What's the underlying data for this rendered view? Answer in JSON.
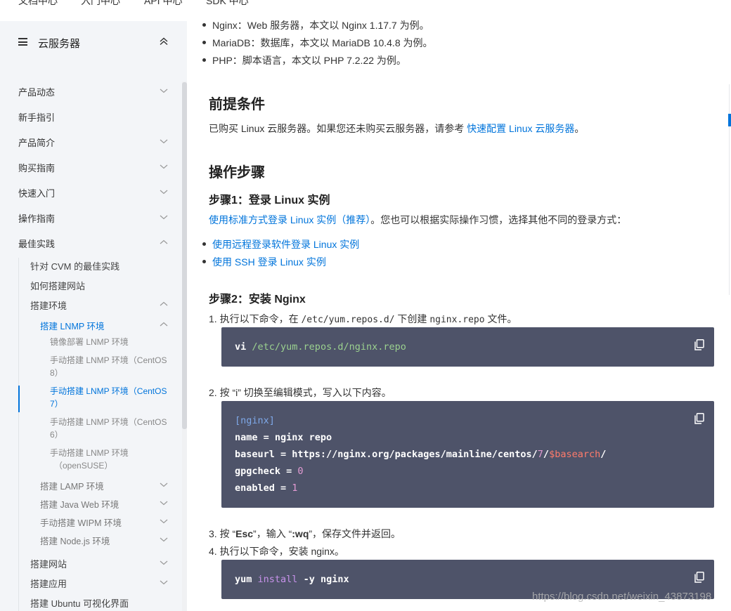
{
  "topnav": [
    "文档中心",
    "入门中心",
    "API 中心",
    "SDK 中心"
  ],
  "sidebar": {
    "title": "云服务器",
    "items": [
      {
        "label": "产品动态",
        "expand": "down"
      },
      {
        "label": "新手指引",
        "expand": "none"
      },
      {
        "label": "产品简介",
        "expand": "down"
      },
      {
        "label": "购买指南",
        "expand": "down"
      },
      {
        "label": "快速入门",
        "expand": "down"
      },
      {
        "label": "操作指南",
        "expand": "down"
      },
      {
        "label": "最佳实践",
        "expand": "up"
      }
    ],
    "best_practice": [
      {
        "label": "针对 CVM 的最佳实践"
      },
      {
        "label": "如何搭建网站"
      },
      {
        "label": "搭建环境"
      }
    ],
    "lnmp": {
      "label": "搭建 LNMP 环境"
    },
    "lnmp_children": [
      {
        "label": "镜像部署 LNMP 环境"
      },
      {
        "label1": "手动搭建 LNMP 环境（CentOS",
        "label2": "8）"
      },
      {
        "label1": "手动搭建 LNMP 环境（CentOS",
        "label2": "7）"
      },
      {
        "label1": "手动搭建 LNMP 环境（CentOS",
        "label2": "6）"
      },
      {
        "label1": "手动搭建 LNMP 环境",
        "label2": "（openSUSE）"
      }
    ],
    "env_more": [
      {
        "label": "搭建 LAMP 环境"
      },
      {
        "label": "搭建 Java Web 环境"
      },
      {
        "label": "手动搭建 WIPM 环境"
      },
      {
        "label": "搭建 Node.js 环境"
      }
    ],
    "bottom": [
      {
        "label": "搭建网站"
      },
      {
        "label": "搭建应用"
      },
      {
        "label": "搭建 Ubuntu 可视化界面"
      }
    ]
  },
  "content": {
    "bullets_top": [
      "Nginx：Web 服务器，本文以 Nginx 1.17.7 为例。",
      "MariaDB：数据库，本文以 MariaDB 10.4.8 为例。",
      "PHP：脚本语言，本文以 PHP 7.2.22 为例。"
    ],
    "prereq_title": "前提条件",
    "prereq_text": "已购买 Linux 云服务器。如果您还未购买云服务器，请参考 ",
    "prereq_link": "快速配置 Linux 云服务器",
    "prereq_end": "。",
    "steps_title": "操作步骤",
    "step1_title": "步骤1：登录 Linux 实例",
    "step1_link": "使用标准方式登录 Linux 实例（推荐）",
    "step1_text": "。您也可以根据实际操作习惯，选择其他不同的登录方式：",
    "step1_links": [
      "使用远程登录软件登录 Linux 实例",
      "使用 SSH 登录 Linux 实例"
    ],
    "step2_title": "步骤2：安装 Nginx",
    "s1_a": "1. 执行以下命令，在 ",
    "s1_code1": "/etc/yum.repos.d/",
    "s1_b": " 下创建 ",
    "s1_code2": "nginx.repo",
    "s1_c": " 文件。",
    "code1_cmd": "vi",
    "code1_arg": "/etc/yum.repos.d/nginx.repo",
    "s2": "2. 按 “i” 切换至编辑模式，写入以下内容。",
    "code2": {
      "l1": "[nginx]",
      "l2": "name = nginx repo",
      "l3a": "baseurl = https://nginx.org/packages/mainline/centos/",
      "l3b": "7",
      "l3c": "/",
      "l3d": "$basearch",
      "l3e": "/",
      "l4a": "gpgcheck = ",
      "l4b": "0",
      "l5a": "enabled = ",
      "l5b": "1"
    },
    "s3a": "3. 按 “",
    "s3b": "Esc",
    "s3c": "”，输入 “",
    "s3d": ":wq",
    "s3e": "”，保存文件并返回。",
    "s4": "4. 执行以下命令，安装 nginx。",
    "code3_cmd": "yum",
    "code3_kw": "install",
    "code3_rest": " -y nginx"
  },
  "watermark": "https://blog.csdn.net/weixin_43873198",
  "colors": {
    "accent": "#0074db",
    "code_bg": "#4e5369",
    "sidebar_bg": "#f3f5f8"
  }
}
